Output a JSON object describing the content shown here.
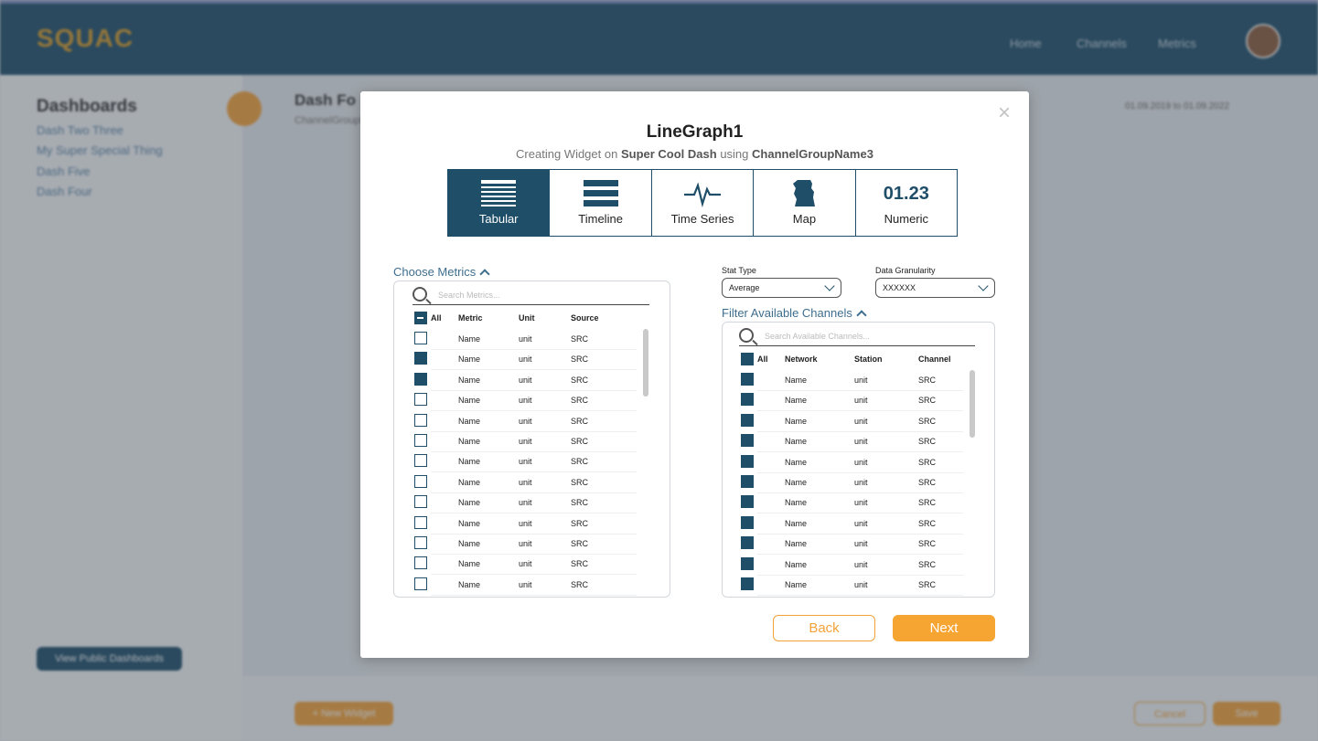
{
  "app": {
    "logo": "SQUAC",
    "nav": [
      "Home",
      "Channels",
      "Metrics"
    ]
  },
  "sidebar": {
    "title": "Dashboards",
    "items": [
      "Dash Two Three",
      "My Super Special Thing",
      "Dash Five",
      "Dash Four"
    ],
    "public_button": "View Public Dashboards"
  },
  "main": {
    "title": "Dash Fo",
    "subtitle": "ChannelGroupN",
    "date": "01.09.2019 to 01.09.2022",
    "new_widget_button": "+ New Widget",
    "footer_buttons": [
      "Cancel",
      "Save"
    ]
  },
  "modal": {
    "title": "LineGraph1",
    "subtitle_prefix": "Creating Widget on ",
    "dashboard_name": "Super Cool Dash",
    "subtitle_mid": " using ",
    "channel_group": "ChannelGroupName3",
    "close_icon": "×",
    "widget_types": [
      {
        "label": "Tabular",
        "icon": "table-icon",
        "active": true
      },
      {
        "label": "Timeline",
        "icon": "timeline-icon",
        "active": false
      },
      {
        "label": "Time Series",
        "icon": "pulse-icon",
        "active": false
      },
      {
        "label": "Map",
        "icon": "map-icon",
        "active": false
      },
      {
        "label": "Numeric",
        "icon": "numeric-icon",
        "numeric_text": "01.23",
        "active": false
      }
    ],
    "metrics": {
      "label": "Choose Metrics",
      "search_placeholder": "Search Metrics...",
      "headers": [
        "All",
        "Metric",
        "Unit",
        "Source"
      ],
      "rows": [
        {
          "name": "Name",
          "unit": "unit",
          "source": "SRC",
          "checked": false
        },
        {
          "name": "Name",
          "unit": "unit",
          "source": "SRC",
          "checked": true
        },
        {
          "name": "Name",
          "unit": "unit",
          "source": "SRC",
          "checked": true
        },
        {
          "name": "Name",
          "unit": "unit",
          "source": "SRC",
          "checked": false
        },
        {
          "name": "Name",
          "unit": "unit",
          "source": "SRC",
          "checked": false
        },
        {
          "name": "Name",
          "unit": "unit",
          "source": "SRC",
          "checked": false
        },
        {
          "name": "Name",
          "unit": "unit",
          "source": "SRC",
          "checked": false
        },
        {
          "name": "Name",
          "unit": "unit",
          "source": "SRC",
          "checked": false
        },
        {
          "name": "Name",
          "unit": "unit",
          "source": "SRC",
          "checked": false
        },
        {
          "name": "Name",
          "unit": "unit",
          "source": "SRC",
          "checked": false
        },
        {
          "name": "Name",
          "unit": "unit",
          "source": "SRC",
          "checked": false
        },
        {
          "name": "Name",
          "unit": "unit",
          "source": "SRC",
          "checked": false
        },
        {
          "name": "Name",
          "unit": "unit",
          "source": "SRC",
          "checked": false
        }
      ]
    },
    "stat_type": {
      "label": "Stat Type",
      "value": "Average"
    },
    "granularity": {
      "label": "Data Granularity",
      "value": "XXXXXX"
    },
    "channels": {
      "label": "Filter Available Channels",
      "search_placeholder": "Search Available Channels...",
      "headers": [
        "All",
        "Network",
        "Station",
        "Channel"
      ],
      "rows": [
        {
          "network": "Name",
          "station": "unit",
          "channel": "SRC",
          "checked": true
        },
        {
          "network": "Name",
          "station": "unit",
          "channel": "SRC",
          "checked": true
        },
        {
          "network": "Name",
          "station": "unit",
          "channel": "SRC",
          "checked": true
        },
        {
          "network": "Name",
          "station": "unit",
          "channel": "SRC",
          "checked": true
        },
        {
          "network": "Name",
          "station": "unit",
          "channel": "SRC",
          "checked": true
        },
        {
          "network": "Name",
          "station": "unit",
          "channel": "SRC",
          "checked": true
        },
        {
          "network": "Name",
          "station": "unit",
          "channel": "SRC",
          "checked": true
        },
        {
          "network": "Name",
          "station": "unit",
          "channel": "SRC",
          "checked": true
        },
        {
          "network": "Name",
          "station": "unit",
          "channel": "SRC",
          "checked": true
        },
        {
          "network": "Name",
          "station": "unit",
          "channel": "SRC",
          "checked": true
        },
        {
          "network": "Name",
          "station": "unit",
          "channel": "SRC",
          "checked": true
        }
      ]
    },
    "back_button": "Back",
    "next_button": "Next"
  },
  "colors": {
    "primary": "#1f4e69",
    "accent": "#f3a23a"
  }
}
